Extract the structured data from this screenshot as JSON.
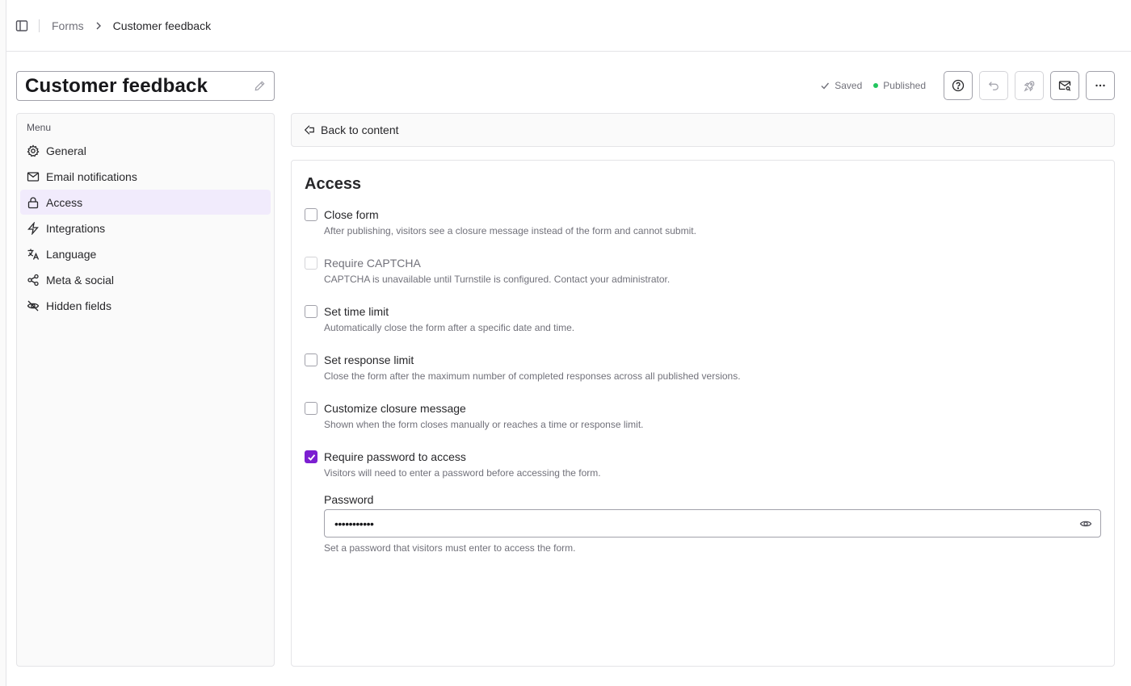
{
  "breadcrumb": {
    "parent": "Forms",
    "current": "Customer feedback"
  },
  "form_title": "Customer feedback",
  "status": {
    "saved": "Saved",
    "published": "Published",
    "published_color": "#22c55e"
  },
  "toolbar": {
    "icons": [
      "help-circle-icon",
      "undo-icon",
      "rocket-icon",
      "mail-search-icon",
      "more-horizontal-icon"
    ]
  },
  "menu": {
    "heading": "Menu",
    "items": [
      {
        "label": "General",
        "icon": "gear-icon",
        "active": false
      },
      {
        "label": "Email notifications",
        "icon": "mail-icon",
        "active": false
      },
      {
        "label": "Access",
        "icon": "lock-icon",
        "active": true
      },
      {
        "label": "Integrations",
        "icon": "lightning-icon",
        "active": false
      },
      {
        "label": "Language",
        "icon": "translate-icon",
        "active": false
      },
      {
        "label": "Meta & social",
        "icon": "share-icon",
        "active": false
      },
      {
        "label": "Hidden fields",
        "icon": "eye-off-icon",
        "active": false
      }
    ]
  },
  "back_link": "Back to content",
  "access": {
    "title": "Access",
    "options": [
      {
        "label": "Close form",
        "description": "After publishing, visitors see a closure message instead of the form and cannot submit.",
        "checked": false,
        "disabled": false
      },
      {
        "label": "Require CAPTCHA",
        "description": "CAPTCHA is unavailable until Turnstile is configured. Contact your administrator.",
        "checked": false,
        "disabled": true
      },
      {
        "label": "Set time limit",
        "description": "Automatically close the form after a specific date and time.",
        "checked": false,
        "disabled": false
      },
      {
        "label": "Set response limit",
        "description": "Close the form after the maximum number of completed responses across all published versions.",
        "checked": false,
        "disabled": false
      },
      {
        "label": "Customize closure message",
        "description": "Shown when the form closes manually or reaches a time or response limit.",
        "checked": false,
        "disabled": false
      },
      {
        "label": "Require password to access",
        "description": "Visitors will need to enter a password before accessing the form.",
        "checked": true,
        "disabled": false
      }
    ],
    "password": {
      "label": "Password",
      "value": "•••••••••••",
      "help": "Set a password that visitors must enter to access the form."
    }
  },
  "colors": {
    "accent": "#7c1fd1",
    "active_menu_bg": "#f1ebfc"
  }
}
